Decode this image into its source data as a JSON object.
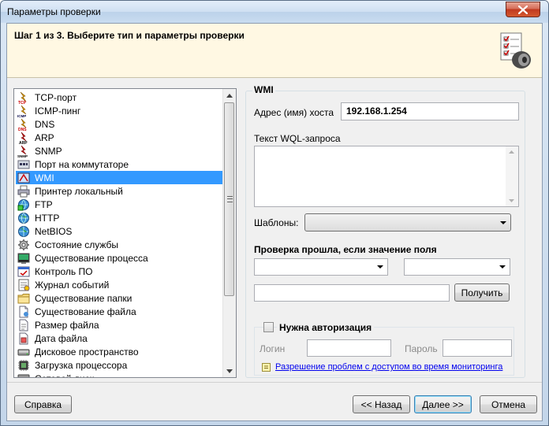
{
  "window": {
    "title": "Параметры проверки",
    "step_title": "Шаг 1 из 3. Выберите тип и параметры проверки"
  },
  "list": {
    "items": [
      {
        "label": "TCP-порт",
        "icon": "tcp-port-icon",
        "selected": false
      },
      {
        "label": "ICMP-пинг",
        "icon": "icmp-ping-icon",
        "selected": false
      },
      {
        "label": "DNS",
        "icon": "dns-icon",
        "selected": false
      },
      {
        "label": "ARP",
        "icon": "arp-icon",
        "selected": false
      },
      {
        "label": "SNMP",
        "icon": "snmp-icon",
        "selected": false
      },
      {
        "label": "Порт на коммутаторе",
        "icon": "switch-port-icon",
        "selected": false
      },
      {
        "label": "WMI",
        "icon": "wmi-icon",
        "selected": true
      },
      {
        "label": "Принтер локальный",
        "icon": "printer-icon",
        "selected": false
      },
      {
        "label": "FTP",
        "icon": "ftp-icon",
        "selected": false
      },
      {
        "label": "HTTP",
        "icon": "http-icon",
        "selected": false
      },
      {
        "label": "NetBIOS",
        "icon": "netbios-icon",
        "selected": false
      },
      {
        "label": "Состояние службы",
        "icon": "service-icon",
        "selected": false
      },
      {
        "label": "Существование процесса",
        "icon": "process-icon",
        "selected": false
      },
      {
        "label": "Контроль ПО",
        "icon": "software-control-icon",
        "selected": false
      },
      {
        "label": "Журнал событий",
        "icon": "event-log-icon",
        "selected": false
      },
      {
        "label": "Существование папки",
        "icon": "folder-icon",
        "selected": false
      },
      {
        "label": "Существование файла",
        "icon": "file-icon",
        "selected": false
      },
      {
        "label": "Размер файла",
        "icon": "file-size-icon",
        "selected": false
      },
      {
        "label": "Дата файла",
        "icon": "file-date-icon",
        "selected": false
      },
      {
        "label": "Дисковое пространство",
        "icon": "disk-space-icon",
        "selected": false
      },
      {
        "label": "Загрузка процессора",
        "icon": "cpu-load-icon",
        "selected": false
      },
      {
        "label": "Сетевой диск",
        "icon": "network-drive-icon",
        "selected": false
      }
    ]
  },
  "wmi": {
    "group_title": "WMI",
    "host_label": "Адрес (имя) хоста",
    "host_value": "192.168.1.254",
    "wql_label": "Текст WQL-запроса",
    "wql_value": "",
    "templates_label": "Шаблоны:",
    "templates_value": "",
    "condition_label": "Проверка прошла, если значение поля",
    "field_value": "",
    "operator_value": "",
    "result_value": "",
    "get_button": "Получить",
    "auth_label": "Нужна авторизация",
    "auth_checked": false,
    "login_label": "Логин",
    "login_value": "",
    "password_label": "Пароль",
    "password_value": "",
    "help_link": "Разрешение проблем с доступом во время мониторинга"
  },
  "footer": {
    "help_button": "Справка",
    "back_button": "<< Назад",
    "next_button": "Далее >>",
    "cancel_button": "Отмена"
  },
  "colors": {
    "selection": "#3399ff",
    "header_band": "#fff8e3",
    "link": "#0000ee",
    "close_button": "#c0391f"
  }
}
